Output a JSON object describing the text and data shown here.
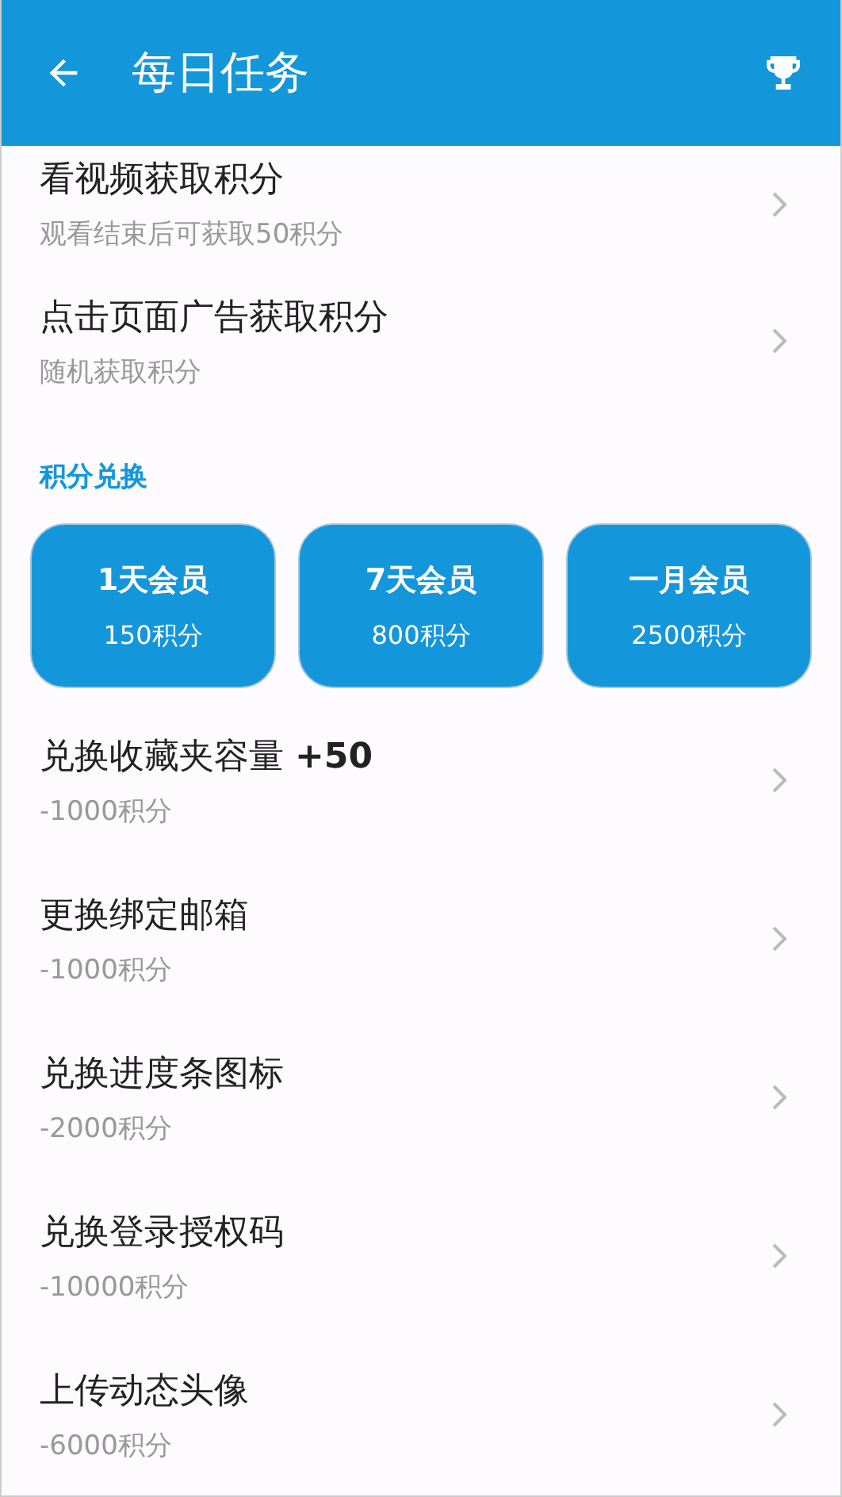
{
  "app_bar": {
    "title": "每日任务"
  },
  "tasks": [
    {
      "title": "看视频获取积分",
      "subtitle": "观看结束后可获取50积分"
    },
    {
      "title": "点击页面广告获取积分",
      "subtitle": "随机获取积分"
    }
  ],
  "exchange": {
    "heading": "积分兑换",
    "memberships": [
      {
        "name": "1天会员",
        "cost": "150积分"
      },
      {
        "name": "7天会员",
        "cost": "800积分"
      },
      {
        "name": "一月会员",
        "cost": "2500积分"
      }
    ],
    "items": [
      {
        "title": "兑换收藏夹容量 **+50**",
        "subtitle": "-1000积分"
      },
      {
        "title": "更换绑定邮箱",
        "subtitle": "-1000积分"
      },
      {
        "title": "兑换进度条图标",
        "subtitle": "-2000积分"
      },
      {
        "title": "兑换登录授权码",
        "subtitle": "-10000积分"
      },
      {
        "title": "上传动态头像",
        "subtitle": "-6000积分"
      }
    ]
  }
}
